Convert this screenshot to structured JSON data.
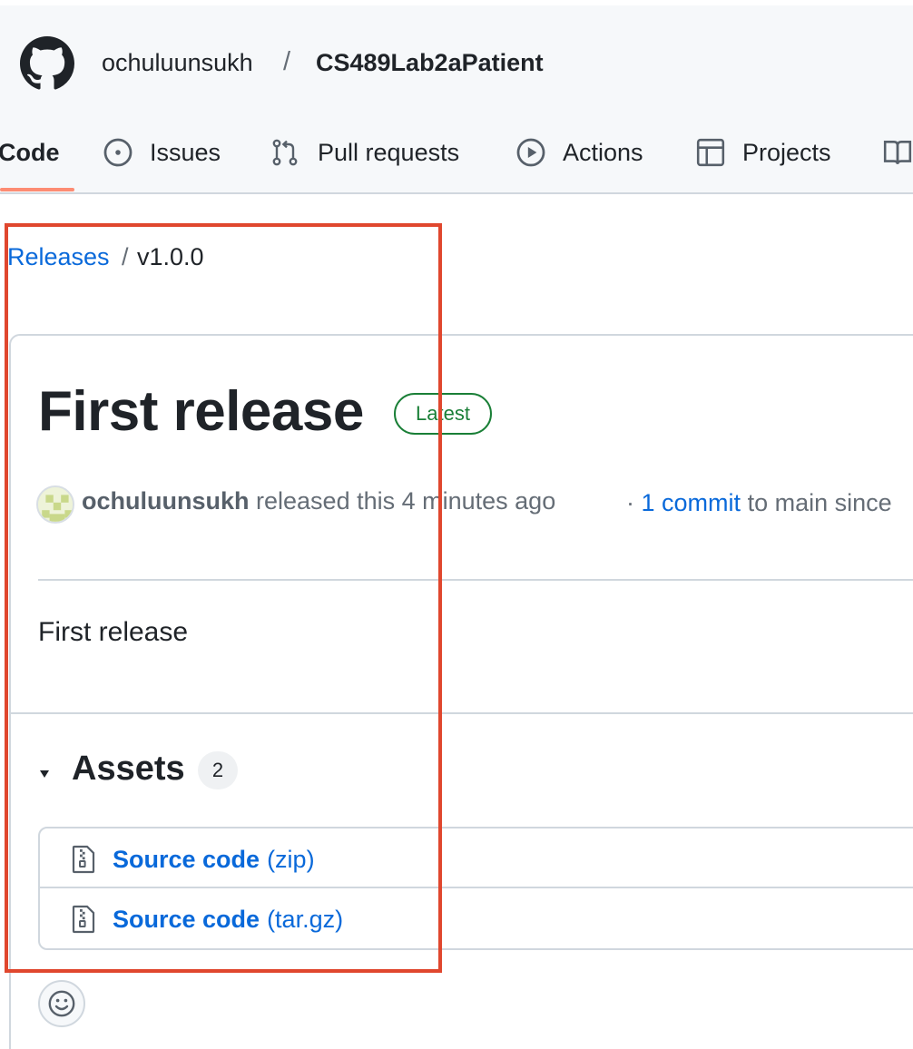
{
  "header": {
    "owner": "ochuluunsukh",
    "separator": "/",
    "repo": "CS489Lab2aPatient",
    "tabs": [
      {
        "label": "Code",
        "icon": "code-icon",
        "active": true
      },
      {
        "label": "Issues",
        "icon": "issue-opened-icon"
      },
      {
        "label": "Pull requests",
        "icon": "git-pull-request-icon"
      },
      {
        "label": "Actions",
        "icon": "play-icon"
      },
      {
        "label": "Projects",
        "icon": "table-icon"
      },
      {
        "label": "",
        "icon": "book-icon"
      }
    ]
  },
  "breadcrumb": {
    "link": "Releases",
    "separator": "/",
    "current": "v1.0.0"
  },
  "release": {
    "title": "First release",
    "badge": "Latest",
    "author": "ochuluunsukh",
    "released_text": "released this 4 minutes ago",
    "commit_prefix": "·",
    "commit_link": "1 commit",
    "commit_suffix": "to main since",
    "notes": "First release",
    "assets_label": "Assets",
    "assets_count": "2",
    "assets": [
      {
        "name": "Source code",
        "ext": "(zip)",
        "icon": "file-zip-icon"
      },
      {
        "name": "Source code",
        "ext": "(tar.gz)",
        "icon": "file-zip-icon"
      }
    ],
    "reaction_icon": "smiley-icon"
  },
  "colors": {
    "link": "#0969da",
    "latest_badge": "#1a7f37",
    "active_tab_underline": "#fd8c73",
    "highlight_box": "#e0472e"
  }
}
